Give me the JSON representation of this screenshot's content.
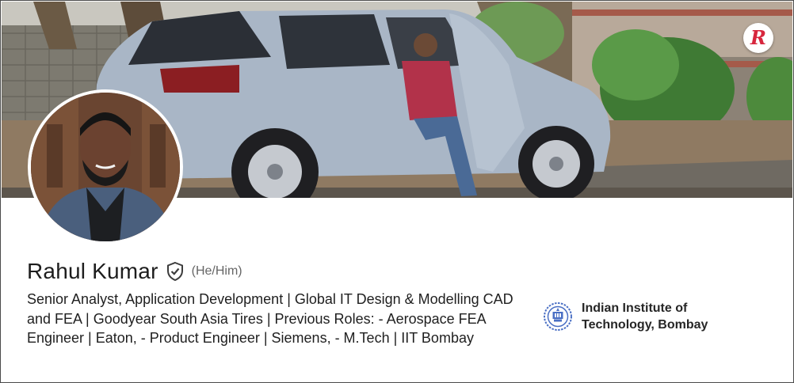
{
  "profile": {
    "name": "Rahul Kumar",
    "pronouns": "(He/Him)",
    "headline": "Senior Analyst, Application Development | Global IT Design & Modelling CAD and FEA | Goodyear South Asia Tires | Previous Roles: - Aerospace FEA Engineer | Eaton, - Product Engineer | Siemens, - M.Tech | IIT Bombay"
  },
  "education": {
    "name": "Indian Institute of Technology, Bombay",
    "logo_icon": "iit-bombay-logo-icon"
  },
  "banner": {
    "brand_letter": "R",
    "brand_color": "#d7263d"
  },
  "icons": {
    "verified": "shield-check-icon"
  }
}
